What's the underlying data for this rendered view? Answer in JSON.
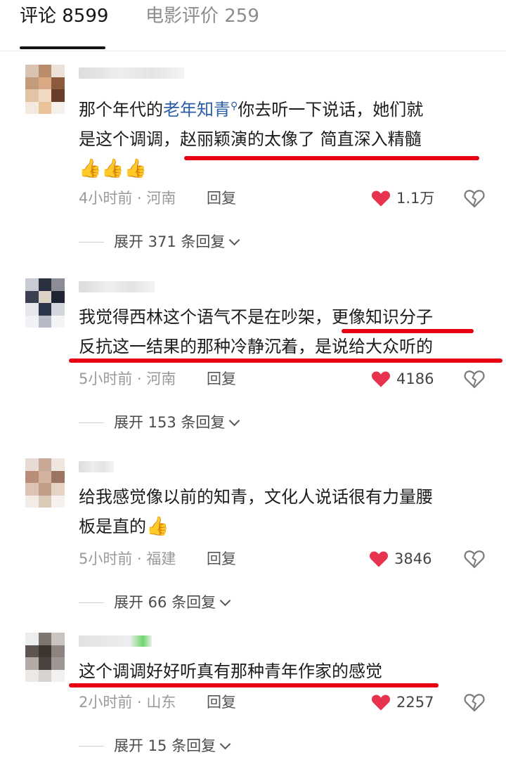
{
  "tabs": [
    {
      "label": "评论 8599"
    },
    {
      "label": "电影评价 259"
    }
  ],
  "comments": [
    {
      "lines": [
        "那个年代的",
        "老年知青",
        "你去听一下说话，她们就",
        "是这个调调，赵丽颖演的太像了 简直深入精髓"
      ],
      "time_location": "4小时前 · 河南",
      "reply_label": "回复",
      "likes": "1.1万",
      "expand_label": "展开 371 条回复"
    },
    {
      "lines": [
        "我觉得西林这个语气不是在吵架，更像知识分子",
        "反抗这一结果的那种冷静沉着，是说给大众听的"
      ],
      "time_location": "5小时前 · 河南",
      "reply_label": "回复",
      "likes": "4186",
      "expand_label": "展开 153 条回复"
    },
    {
      "lines": [
        "给我感觉像以前的知青，文化人说话很有力量腰",
        "板是直的"
      ],
      "time_location": "5小时前 · 福建",
      "reply_label": "回复",
      "likes": "3846",
      "expand_label": "展开 66 条回复"
    },
    {
      "lines": [
        "这个调调好好听真有那种青年作家的感觉"
      ],
      "time_location": "2小时前 · 山东",
      "reply_label": "回复",
      "likes": "2257",
      "expand_label": "展开 15 条回复"
    }
  ],
  "colors": {
    "accent_red": "#e60012",
    "heart": "#e8334f",
    "link_blue": "#2a5ea8"
  },
  "icons": {
    "like": "heart-icon",
    "dislike": "broken-heart-icon",
    "emoji": "thumbs-up-icon",
    "search": "search-icon"
  }
}
